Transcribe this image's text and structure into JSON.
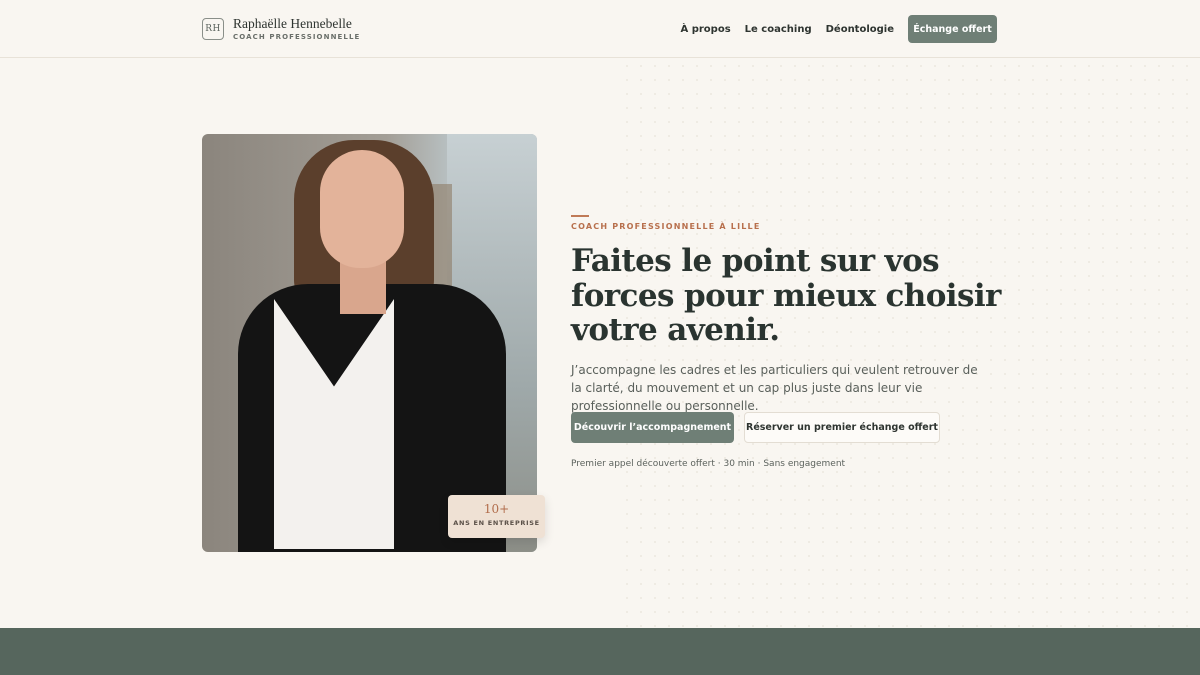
{
  "header": {
    "monogram": "RH",
    "brand_name": "Raphaëlle Hennebelle",
    "brand_subtitle": "COACH PROFESSIONNELLE",
    "nav": [
      {
        "label": "À propos"
      },
      {
        "label": "Le coaching"
      },
      {
        "label": "Déontologie"
      }
    ],
    "cta_label": "Échange offert"
  },
  "hero": {
    "eyebrow": "COACH PROFESSIONNELLE À LILLE",
    "headline": "Faites le point sur vos forces pour mieux choisir votre avenir.",
    "lead": "J’accompagne les cadres et les particuliers qui veulent retrouver de la clarté, du mouvement et un cap plus juste dans leur vie professionnelle ou personnelle.",
    "primary_button": "Découvrir l’accompagnement",
    "secondary_button": "Réserver un premier échange offert",
    "note": "Premier appel découverte offert · 30 min · Sans engagement"
  },
  "badge": {
    "number": "10+",
    "label": "ANS EN ENTREPRISE"
  },
  "colors": {
    "background": "#f9f6f1",
    "accent_green": "#6f7f76",
    "accent_copper": "#b8704d",
    "footer_band": "#56665d"
  }
}
